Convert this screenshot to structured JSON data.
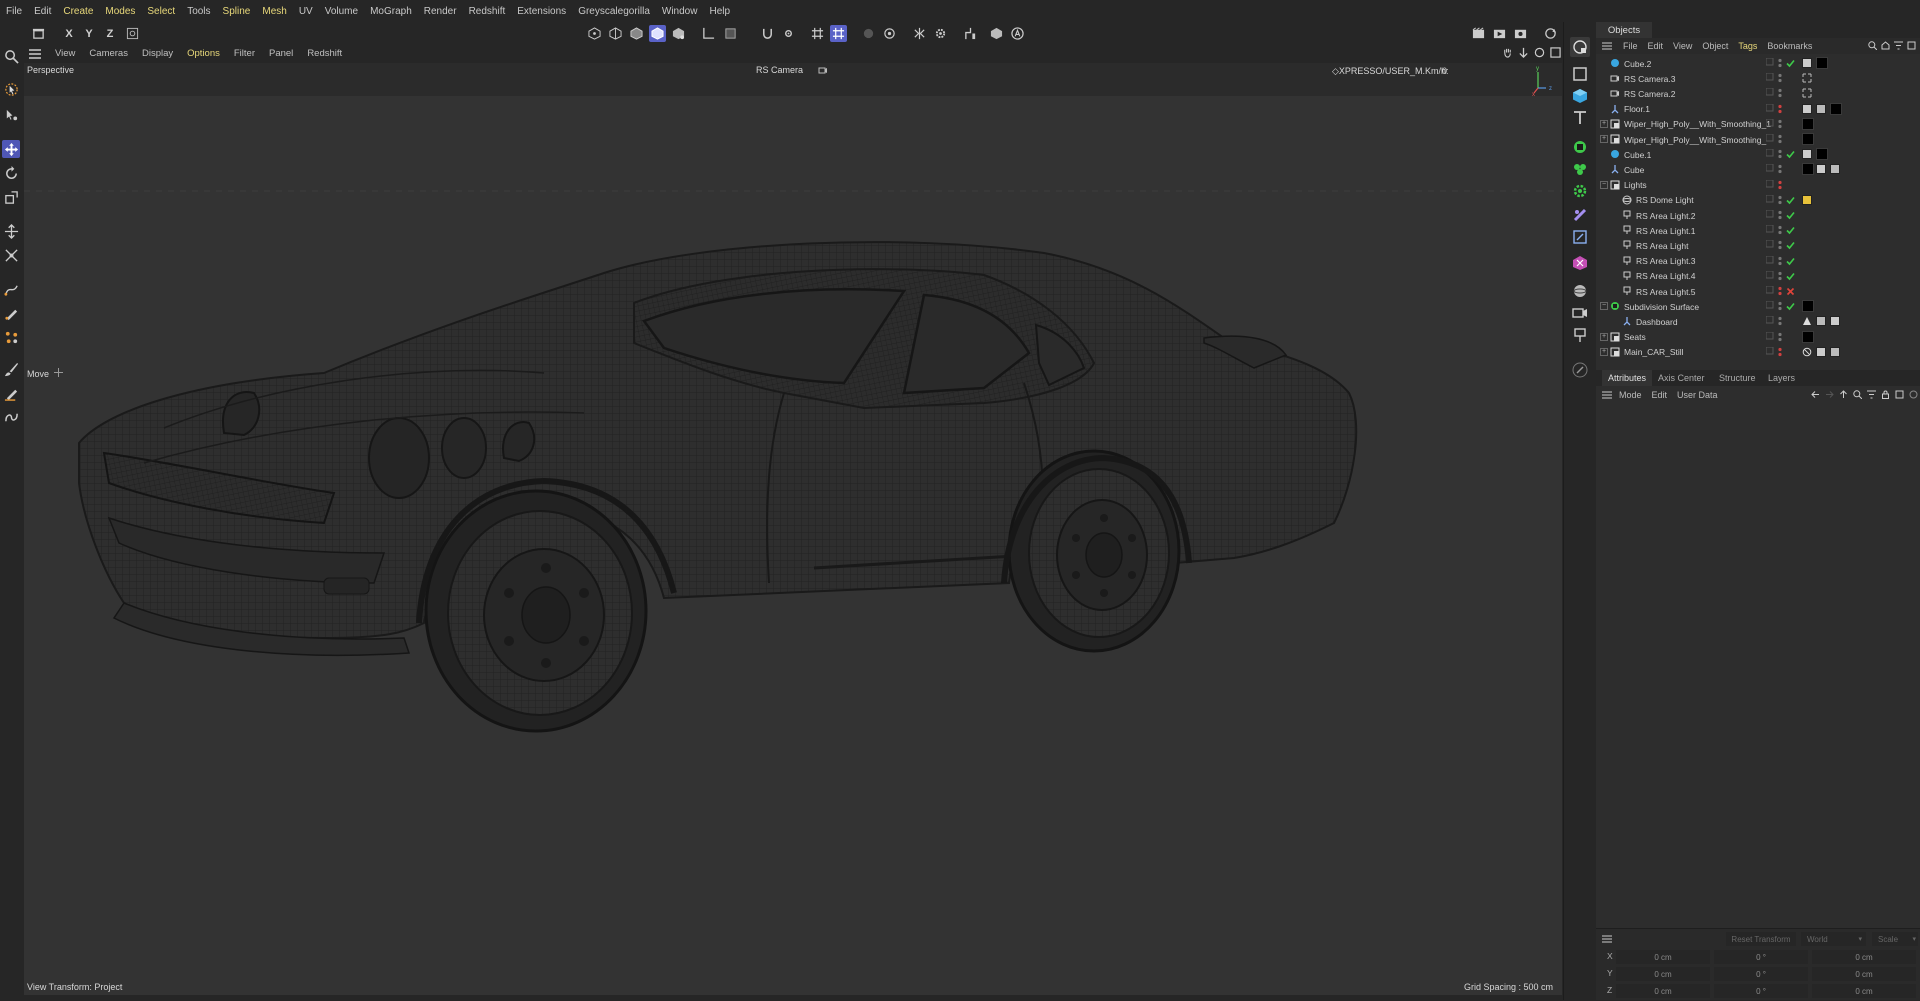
{
  "menubar": {
    "items": [
      "File",
      "Edit",
      "Create",
      "Modes",
      "Select",
      "Tools",
      "Spline",
      "Mesh",
      "UV",
      "Volume",
      "MoGraph",
      "Render",
      "Redshift",
      "Extensions",
      "Greyscalegorilla",
      "Window",
      "Help"
    ]
  },
  "topbar": {
    "axis_x": "X",
    "axis_y": "Y",
    "axis_z": "Z"
  },
  "viewport_menu": {
    "items": [
      "View",
      "Cameras",
      "Display",
      "Options",
      "Filter",
      "Panel",
      "Redshift"
    ]
  },
  "viewport": {
    "projection": "Perspective",
    "camera": "RS Camera",
    "xpresso_label": "◇XPRESSO/USER_M.Km/h:",
    "xpresso_value": "0",
    "tool_label": "Move",
    "view_transform": "View Transform: Project",
    "grid_spacing": "Grid Spacing : 500 cm",
    "axis_x": "x",
    "axis_y": "y",
    "axis_z": "z"
  },
  "objects": {
    "tab": "Objects",
    "menu": [
      "File",
      "Edit",
      "View",
      "Object",
      "Tags",
      "Bookmarks"
    ],
    "rows": [
      {
        "name": "Cube.2",
        "icon": "cube-object-icon"
      },
      {
        "name": "RS Camera.3",
        "icon": "camera-icon"
      },
      {
        "name": "RS Camera.2",
        "icon": "camera-icon"
      },
      {
        "name": "Floor.1",
        "icon": "floor-icon"
      },
      {
        "name": "Wiper_High_Poly__With_Smoothing_1",
        "icon": "null-icon"
      },
      {
        "name": "Wiper_High_Poly__With_Smoothing_",
        "icon": "null-icon"
      },
      {
        "name": "Cube.1",
        "icon": "cube-object-icon"
      },
      {
        "name": "Cube",
        "icon": "floor-icon"
      },
      {
        "name": "Lights",
        "icon": "null-icon"
      },
      {
        "name": "RS Dome Light",
        "icon": "dome-light-icon"
      },
      {
        "name": "RS Area Light.2",
        "icon": "area-light-icon"
      },
      {
        "name": "RS Area Light.1",
        "icon": "area-light-icon"
      },
      {
        "name": "RS Area Light",
        "icon": "area-light-icon"
      },
      {
        "name": "RS Area Light.3",
        "icon": "area-light-icon"
      },
      {
        "name": "RS Area Light.4",
        "icon": "area-light-icon"
      },
      {
        "name": "RS Area Light.5",
        "icon": "area-light-icon"
      },
      {
        "name": "Subdivision Surface",
        "icon": "subdivision-icon"
      },
      {
        "name": "Dashboard",
        "icon": "floor-icon"
      },
      {
        "name": "Seats",
        "icon": "null-icon"
      },
      {
        "name": "Main_CAR_Still",
        "icon": "null-icon"
      }
    ]
  },
  "attributes": {
    "tabs": [
      "Attributes",
      "Axis Center",
      "Structure",
      "Layers"
    ],
    "menu": [
      "Mode",
      "Edit",
      "User Data"
    ],
    "reset_transform": "Reset Transform",
    "world": "World",
    "scale": "Scale",
    "coords": [
      {
        "axis": "X",
        "pos": "0 cm",
        "rot": "0 °",
        "size": "0 cm"
      },
      {
        "axis": "Y",
        "pos": "0 cm",
        "rot": "0 °",
        "size": "0 cm"
      },
      {
        "axis": "Z",
        "pos": "0 cm",
        "rot": "0 °",
        "size": "0 cm"
      }
    ]
  },
  "colors": {
    "accent": "#5a62c7",
    "check_green": "#3ec94a",
    "check_red": "#e0443a",
    "highlight_text": "#e8d87a"
  }
}
